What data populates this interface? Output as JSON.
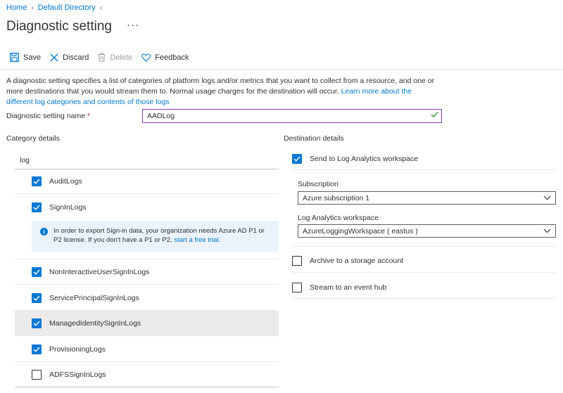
{
  "breadcrumb": [
    {
      "label": "Home"
    },
    {
      "label": "Default Directory"
    }
  ],
  "page": {
    "title": "Diagnostic setting",
    "more": "···"
  },
  "toolbar": {
    "save": "Save",
    "discard": "Discard",
    "delete": "Delete",
    "feedback": "Feedback"
  },
  "description": {
    "text": "A diagnostic setting specifies a list of categories of platform logs and/or metrics that you want to collect from a resource, and one or more destinations that you would stream them to. Normal usage charges for the destination will occur. ",
    "link": "Learn more about the different log categories and contents of those logs"
  },
  "setting_name": {
    "label": "Diagnostic setting name",
    "required": "*",
    "value": "AADLog"
  },
  "category": {
    "title": "Category details",
    "group": "log",
    "items": [
      {
        "label": "AuditLogs",
        "checked": true
      },
      {
        "label": "SignInLogs",
        "checked": true
      },
      {
        "label": "NonInteractiveUserSignInLogs",
        "checked": true
      },
      {
        "label": "ServicePrincipalSignInLogs",
        "checked": true
      },
      {
        "label": "ManagedIdentitySignInLogs",
        "checked": true
      },
      {
        "label": "ProvisioningLogs",
        "checked": true
      },
      {
        "label": "ADFSSignInLogs",
        "checked": false
      }
    ],
    "info": {
      "text": "In order to export Sign-in data, your organization needs Azure AD P1 or P2 license. If you don't have a P1 or P2, ",
      "link": "start a free trial."
    }
  },
  "destination": {
    "title": "Destination details",
    "log_analytics": {
      "label": "Send to Log Analytics workspace",
      "checked": true
    },
    "subscription": {
      "label": "Subscription",
      "value": "Azure subscription 1"
    },
    "workspace": {
      "label": "Log Analytics workspace",
      "value": "AzureLoggingWorkspace ( eastus )"
    },
    "storage": {
      "label": "Archive to a storage account",
      "checked": false
    },
    "event_hub": {
      "label": "Stream to an event hub",
      "checked": false
    }
  },
  "colors": {
    "accent": "#0078d4",
    "input_focus": "#8a3ab9",
    "valid": "#107c10",
    "required": "#a4262c"
  }
}
